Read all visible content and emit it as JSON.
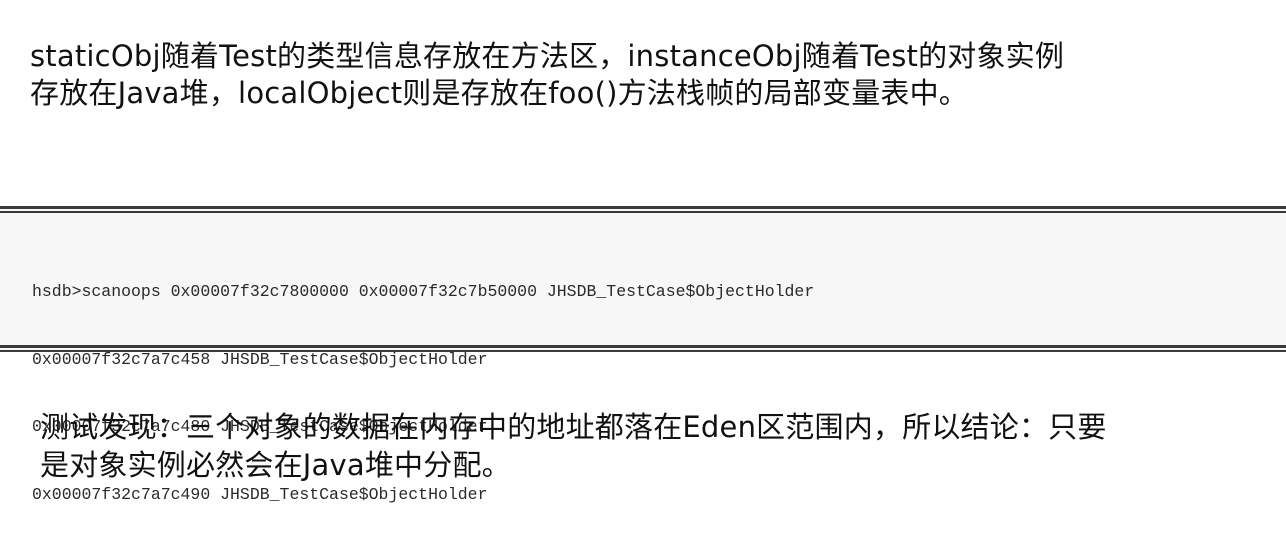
{
  "top_paragraph": {
    "line1": "staticObj随着Test的类型信息存放在方法区，instanceObj随着Test的对象实例",
    "line2": "存放在Java堆，localObject则是存放在foo()方法栈帧的局部变量表中。"
  },
  "code_block": {
    "lines": [
      "hsdb>scanoops 0x00007f32c7800000 0x00007f32c7b50000 JHSDB_TestCase$ObjectHolder",
      "0x00007f32c7a7c458 JHSDB_TestCase$ObjectHolder",
      "0x00007f32c7a7c480 JHSDB_TestCase$ObjectHolder",
      "0x00007f32c7a7c490 JHSDB_TestCase$ObjectHolder"
    ]
  },
  "bottom_paragraph": {
    "line1": "测试发现：三个对象的数据在内存中的地址都落在Eden区范围内，所以结论：只要",
    "line2": "是对象实例必然会在Java堆中分配。"
  }
}
